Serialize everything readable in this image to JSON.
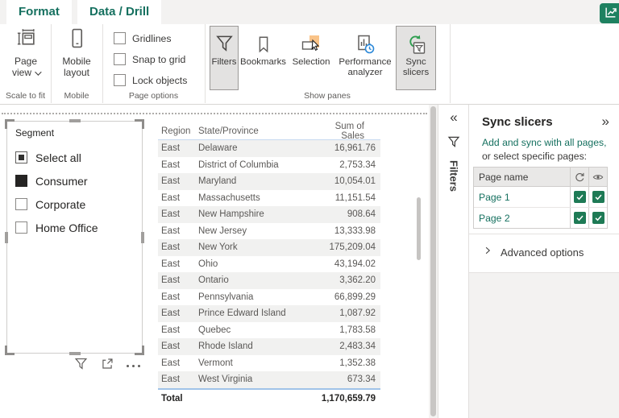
{
  "ribbon": {
    "tabs": [
      {
        "label": "Format"
      },
      {
        "label": "Data / Drill"
      }
    ],
    "scale_to_fit": {
      "group_label": "Scale to fit",
      "page_view_label": "Page view"
    },
    "mobile": {
      "group_label": "Mobile",
      "mobile_layout_label": "Mobile layout"
    },
    "page_options": {
      "group_label": "Page options",
      "checkboxes": [
        {
          "label": "Gridlines",
          "checked": false
        },
        {
          "label": "Snap to grid",
          "checked": false
        },
        {
          "label": "Lock objects",
          "checked": false
        }
      ]
    },
    "show_panes": {
      "group_label": "Show panes",
      "buttons": [
        {
          "label": "Filters",
          "icon": "funnel-icon",
          "active": true
        },
        {
          "label": "Bookmarks",
          "icon": "bookmark-icon",
          "active": false
        },
        {
          "label": "Selection",
          "icon": "selection-icon",
          "active": false
        },
        {
          "label": "Performance analyzer",
          "icon": "performance-analyzer-icon",
          "active": false
        },
        {
          "label": "Sync slicers",
          "icon": "sync-slicers-icon",
          "active": true
        }
      ]
    },
    "top_right_button": {
      "icon": "chart-arrow-icon",
      "color": "#1E8160"
    }
  },
  "canvas": {
    "slicer": {
      "title": "Segment",
      "items": [
        {
          "label": "Select all",
          "state": "partial"
        },
        {
          "label": "Consumer",
          "state": "checked"
        },
        {
          "label": "Corporate",
          "state": "unchecked"
        },
        {
          "label": "Home Office",
          "state": "unchecked"
        }
      ],
      "footer_icons": [
        "filter-icon",
        "focus-mode-icon",
        "more-options-icon"
      ]
    },
    "table": {
      "columns": [
        "Region",
        "State/Province",
        "Sum of Sales"
      ],
      "rows": [
        {
          "region": "East",
          "state": "Delaware",
          "sales": "16,961.76"
        },
        {
          "region": "East",
          "state": "District of Columbia",
          "sales": "2,753.34"
        },
        {
          "region": "East",
          "state": "Maryland",
          "sales": "10,054.01"
        },
        {
          "region": "East",
          "state": "Massachusetts",
          "sales": "11,151.54"
        },
        {
          "region": "East",
          "state": "New Hampshire",
          "sales": "908.64"
        },
        {
          "region": "East",
          "state": "New Jersey",
          "sales": "13,333.98"
        },
        {
          "region": "East",
          "state": "New York",
          "sales": "175,209.04"
        },
        {
          "region": "East",
          "state": "Ohio",
          "sales": "43,194.02"
        },
        {
          "region": "East",
          "state": "Ontario",
          "sales": "3,362.20"
        },
        {
          "region": "East",
          "state": "Pennsylvania",
          "sales": "66,899.29"
        },
        {
          "region": "East",
          "state": "Prince Edward Island",
          "sales": "1,087.92"
        },
        {
          "region": "East",
          "state": "Quebec",
          "sales": "1,783.58"
        },
        {
          "region": "East",
          "state": "Rhode Island",
          "sales": "2,483.34"
        },
        {
          "region": "East",
          "state": "Vermont",
          "sales": "1,352.38"
        },
        {
          "region": "East",
          "state": "West Virginia",
          "sales": "673.34"
        }
      ],
      "total_label": "Total",
      "total_value": "1,170,659.79"
    }
  },
  "filters_pane": {
    "label": "Filters",
    "collapse_glyph": "«",
    "icon": "funnel-icon"
  },
  "sync_slicers_pane": {
    "title": "Sync slicers",
    "expand_glyph": "»",
    "description_line1": "Add and sync with all pages,",
    "description_line2": "or select specific pages:",
    "pages_table": {
      "name_header": "Page name",
      "sync_column_icon": "sync-icon",
      "visibility_column_icon": "eye-icon",
      "rows": [
        {
          "name": "Page 1",
          "sync": true,
          "visible": true
        },
        {
          "name": "Page 2",
          "sync": true,
          "visible": true
        }
      ]
    },
    "advanced_options_label": "Advanced options"
  },
  "colors": {
    "accent_teal": "#15705F",
    "checkbox_green": "#1E7A55",
    "publish_green": "#1E8160",
    "selection_orange": "#F9C388",
    "stopwatch_blue": "#2B88D8",
    "sync_arrows_green": "#2E9E4F",
    "row_stripe": "#F1F1F0",
    "total_border_blue": "#A0C3E8"
  }
}
